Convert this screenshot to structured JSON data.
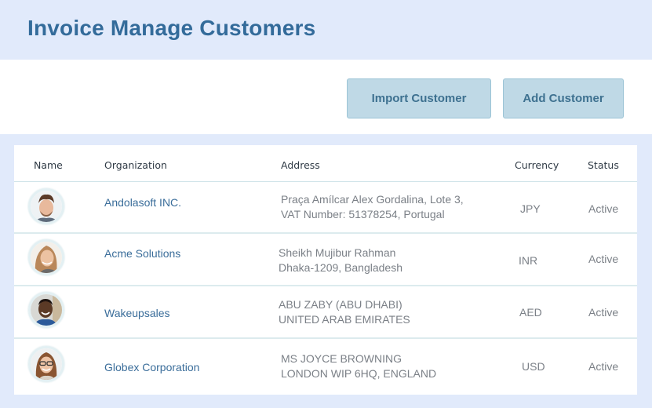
{
  "header": {
    "title": "Invoice Manage Customers"
  },
  "toolbar": {
    "import_label": "Import Customer",
    "add_label": "Add Customer"
  },
  "table": {
    "columns": [
      "Name",
      "Organization",
      "Address",
      "Currency",
      "Status"
    ],
    "rows": [
      {
        "avatar": "avatar-man-beard",
        "organization": "Andolasoft INC.",
        "address_line1": "Praça Amílcar Alex Gordalina, Lote 3,",
        "address_line2": "VAT Number: 51378254, Portugal",
        "currency": "JPY",
        "status": "Active"
      },
      {
        "avatar": "avatar-woman-blonde",
        "organization": "Acme Solutions",
        "address_line1": "Sheikh Mujibur Rahman",
        "address_line2": "Dhaka-1209, Bangladesh",
        "currency": "INR",
        "status": "Active"
      },
      {
        "avatar": "avatar-man-smiling",
        "organization": "Wakeupsales",
        "address_line1": "ABU ZABY (ABU DHABI)",
        "address_line2": "UNITED ARAB EMIRATES",
        "currency": "AED",
        "status": "Active"
      },
      {
        "avatar": "avatar-woman-glasses",
        "organization": "Globex Corporation",
        "address_line1": "MS JOYCE BROWNING",
        "address_line2": "LONDON WIP 6HQ, ENGLAND",
        "currency": "USD",
        "status": "Active"
      }
    ]
  }
}
